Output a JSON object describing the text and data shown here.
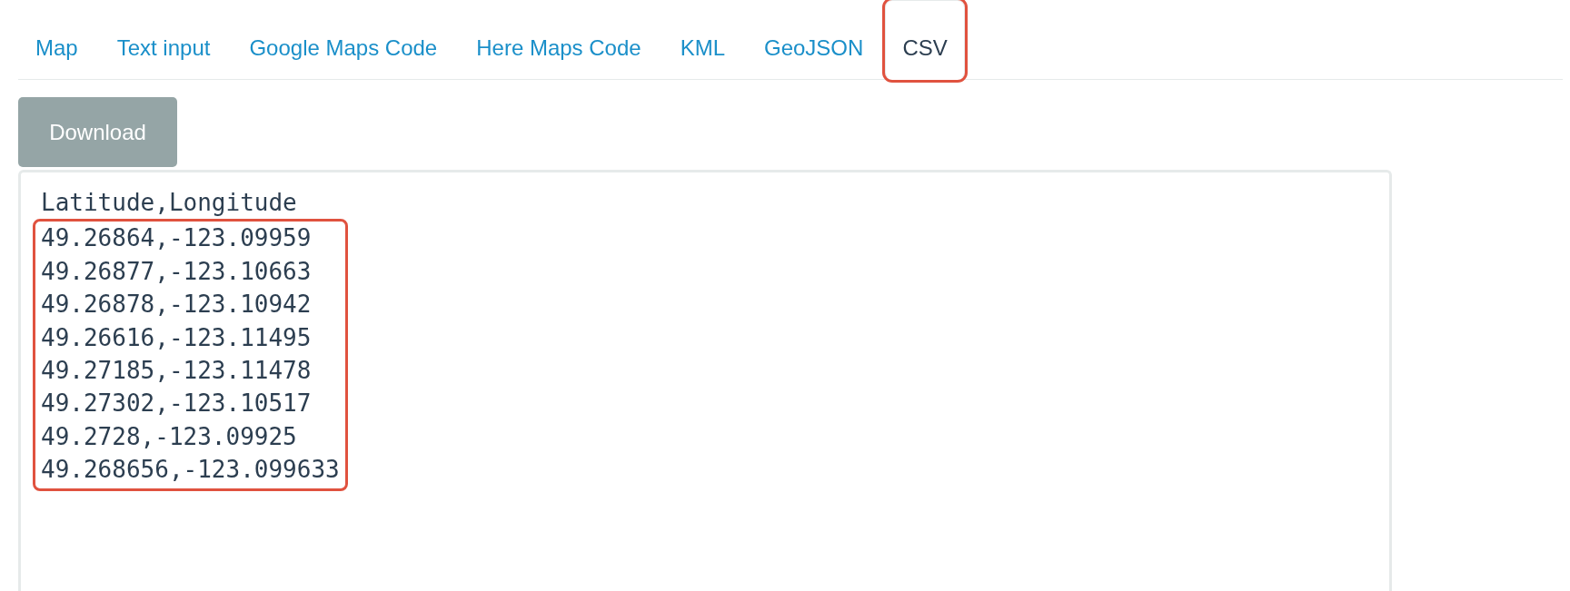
{
  "tabs": [
    {
      "label": "Map",
      "selected": false,
      "highlighted": false
    },
    {
      "label": "Text input",
      "selected": false,
      "highlighted": false
    },
    {
      "label": "Google Maps Code",
      "selected": false,
      "highlighted": false
    },
    {
      "label": "Here Maps Code",
      "selected": false,
      "highlighted": false
    },
    {
      "label": "KML",
      "selected": false,
      "highlighted": false
    },
    {
      "label": "GeoJSON",
      "selected": false,
      "highlighted": false
    },
    {
      "label": "CSV",
      "selected": true,
      "highlighted": true
    }
  ],
  "download_button": {
    "label": "Download"
  },
  "csv_output": {
    "header": "Latitude,Longitude",
    "rows_highlighted": true,
    "rows": [
      "49.26864,-123.09959",
      "49.26877,-123.10663",
      "49.26878,-123.10942",
      "49.26616,-123.11495",
      "49.27185,-123.11478",
      "49.27302,-123.10517",
      "49.2728,-123.09925",
      "49.268656,-123.099633"
    ]
  }
}
